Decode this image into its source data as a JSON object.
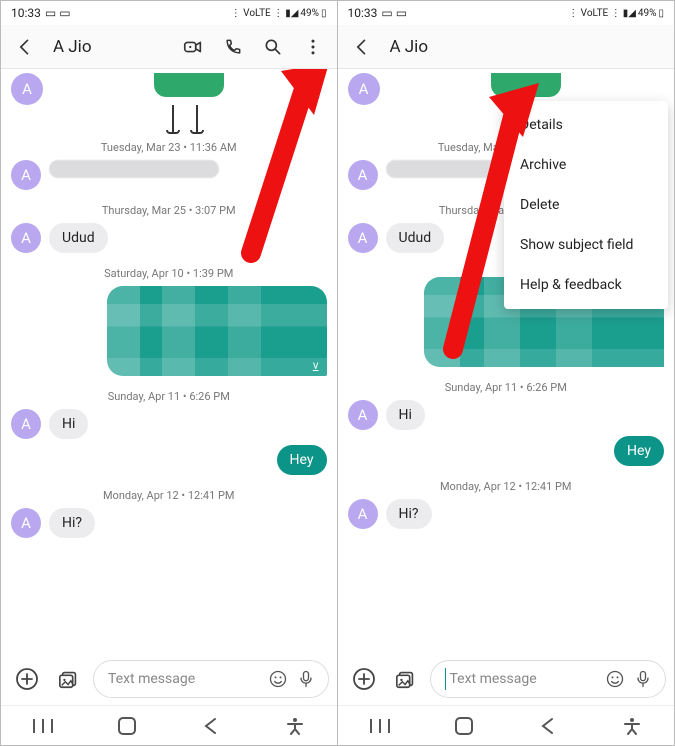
{
  "status": {
    "time": "10:33",
    "battery": "49%",
    "net": "LTE2"
  },
  "header": {
    "title": "A Jio"
  },
  "avatar_letter": "A",
  "dates": {
    "d1": "Tuesday, Mar 23 • 11:36 AM",
    "d2": "Thursday, Mar 25 • 3:07 PM",
    "d3": "Saturday, Apr 10 • 1:39 PM",
    "d4": "Sunday, Apr 11 • 6:26 PM",
    "d5": "Monday, Apr 12 • 12:41 PM"
  },
  "messages": {
    "udud": "Udud",
    "hi": "Hi",
    "hey": "Hey",
    "hi_q": "Hi?",
    "teal_under": "v"
  },
  "composer": {
    "placeholder": "Text message"
  },
  "menu": {
    "details": "Details",
    "archive": "Archive",
    "delete": "Delete",
    "subject": "Show subject field",
    "help": "Help & feedback"
  }
}
